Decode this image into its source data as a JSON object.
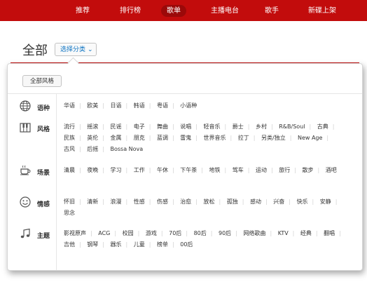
{
  "nav": {
    "items": [
      {
        "label": "推荐",
        "active": false
      },
      {
        "label": "排行榜",
        "active": false
      },
      {
        "label": "歌单",
        "active": true
      },
      {
        "label": "主播电台",
        "active": false
      },
      {
        "label": "歌手",
        "active": false
      },
      {
        "label": "新碟上架",
        "active": false
      }
    ]
  },
  "page": {
    "heading": "全部",
    "select_label": "选择分类"
  },
  "panel": {
    "all_styles_label": "全部风格",
    "categories": [
      {
        "label": "语种",
        "icon": "globe-icon",
        "tags": [
          "华语",
          "欧美",
          "日语",
          "韩语",
          "粤语",
          "小语种"
        ]
      },
      {
        "label": "风格",
        "icon": "piano-icon",
        "tags": [
          "流行",
          "摇滚",
          "民谣",
          "电子",
          "舞曲",
          "说唱",
          "轻音乐",
          "爵士",
          "乡村",
          "R&B/Soul",
          "古典",
          "民族",
          "英伦",
          "金属",
          "朋克",
          "蓝调",
          "雷鬼",
          "世界音乐",
          "拉丁",
          "另类/独立",
          "New Age",
          "古风",
          "后摇",
          "Bossa Nova"
        ]
      },
      {
        "label": "场景",
        "icon": "coffee-icon",
        "tags": [
          "清晨",
          "夜晚",
          "学习",
          "工作",
          "午休",
          "下午茶",
          "地铁",
          "驾车",
          "运动",
          "旅行",
          "散步",
          "酒吧"
        ]
      },
      {
        "label": "情感",
        "icon": "smiley-icon",
        "tags": [
          "怀旧",
          "清新",
          "浪漫",
          "性感",
          "伤感",
          "治愈",
          "放松",
          "孤独",
          "感动",
          "兴奋",
          "快乐",
          "安静",
          "思念"
        ]
      },
      {
        "label": "主题",
        "icon": "music-note-icon",
        "tags": [
          "影视原声",
          "ACG",
          "校园",
          "游戏",
          "70后",
          "80后",
          "90后",
          "网络歌曲",
          "KTV",
          "经典",
          "翻唱",
          "吉他",
          "钢琴",
          "器乐",
          "儿童",
          "榜单",
          "00后"
        ]
      }
    ]
  },
  "colors": {
    "brand_red": "#c20c0c",
    "link_blue": "#0c73c2"
  }
}
